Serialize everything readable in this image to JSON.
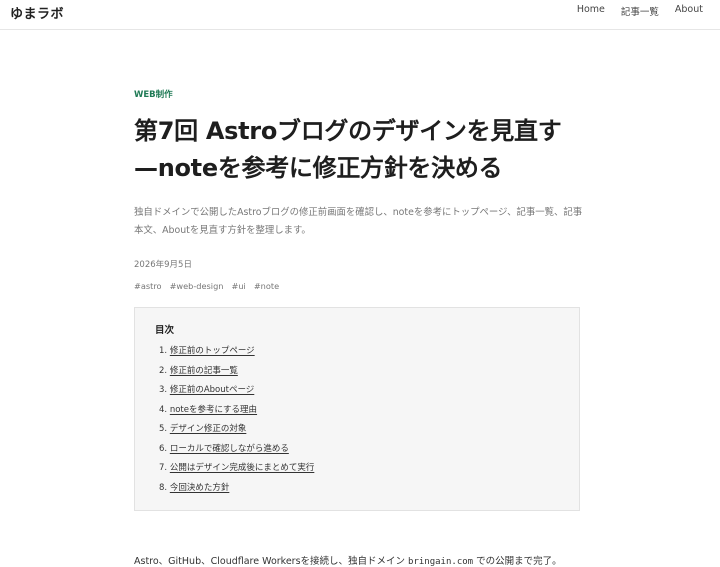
{
  "header": {
    "brand": "ゆまラボ",
    "nav": [
      "Home",
      "記事一覧",
      "About"
    ]
  },
  "article": {
    "category": "WEB制作",
    "title_line1": "第7回 Astroブログのデザインを見直す",
    "title_line2": "—noteを参考に修正方針を決める",
    "lead": "独自ドメインで公開したAstroブログの修正前画面を確認し、noteを参考にトップページ、記事一覧、記事本文、Aboutを見直す方針を整理します。",
    "date": "2026年9月5日",
    "tags": [
      "#astro",
      "#web-design",
      "#ui",
      "#note"
    ]
  },
  "toc": {
    "title": "目次",
    "items": [
      "修正前のトップページ",
      "修正前の記事一覧",
      "修正前のAboutページ",
      "noteを参考にする理由",
      "デザイン修正の対象",
      "ローカルで確認しながら進める",
      "公開はデザイン完成後にまとめて実行",
      "今回決めた方針"
    ]
  },
  "body": {
    "text_before": "Astro、GitHub、Cloudflare Workersを接続し、独自ドメイン ",
    "domain": "bringain.com",
    "text_after": " での公開まで完了。"
  }
}
